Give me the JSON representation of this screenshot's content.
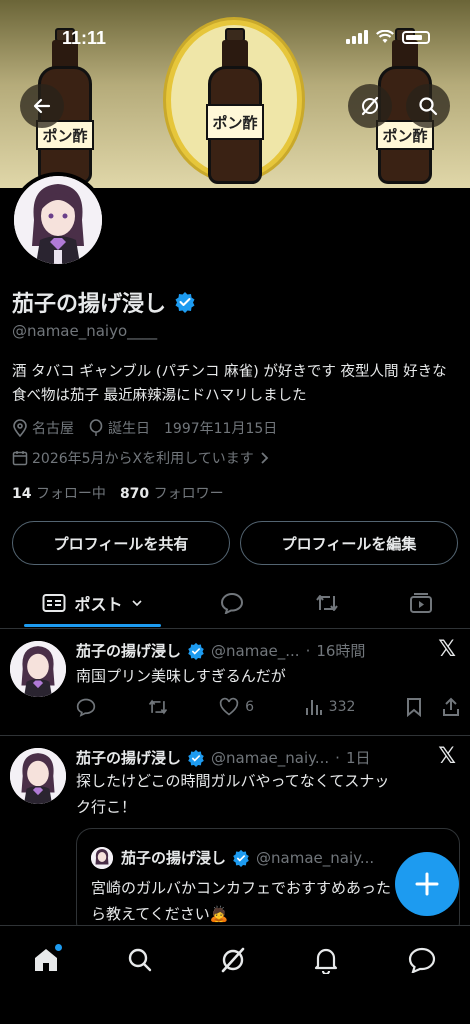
{
  "status_bar": {
    "time": "11:11"
  },
  "banner": {
    "bottle_label": "ポン酢"
  },
  "profile": {
    "display_name": "茄子の揚げ浸し",
    "handle": "@namae_naiyo____",
    "bio": "酒 タバコ ギャンブル (パチンコ 麻雀) が好きです 夜型人間 好きな食べ物は茄子 最近麻辣湯にドハマリしました",
    "location": "名古屋",
    "birthday_label": "誕生日",
    "birthday": "1997年11月15日",
    "joined": "2026年5月からXを利用しています",
    "following_count": "14",
    "following_label": "フォロー中",
    "followers_count": "870",
    "followers_label": "フォロワー",
    "share_button": "プロフィールを共有",
    "edit_button": "プロフィールを編集"
  },
  "tabs": {
    "posts_label": "ポスト"
  },
  "tweets": [
    {
      "name": "茄子の揚げ浸し",
      "handle": "@namae_...",
      "time": "16時間",
      "text": "南国プリン美味しすぎるんだが",
      "likes": "6",
      "views": "332"
    },
    {
      "name": "茄子の揚げ浸し",
      "handle": "@namae_naiy...",
      "time": "1日",
      "text_line1": "探したけどこの時間ガルバやってなくてスナッ",
      "text_line2": "ク行こ！",
      "quote": {
        "name": "茄子の揚げ浸し",
        "handle": "@namae_naiy...",
        "text_line1": "宮崎のガルバかコンカフェでおすすめあった",
        "text_line2": "ら教えてください🙇"
      }
    }
  ],
  "colors": {
    "accent": "#1d9bf0",
    "muted": "#71767b",
    "text": "#e7e9ea",
    "border": "#2f3336"
  },
  "icons": [
    "back-arrow-icon",
    "grok-icon",
    "search-icon",
    "location-icon",
    "balloon-icon",
    "calendar-icon",
    "chevron-right-icon",
    "posts-tab-icon",
    "reply-icon",
    "repost-icon",
    "media-icon",
    "like-icon",
    "views-icon",
    "bookmark-icon",
    "share-icon",
    "x-logo-icon",
    "verified-badge-icon",
    "compose-plus-icon",
    "home-icon",
    "notifications-icon",
    "messages-icon"
  ]
}
